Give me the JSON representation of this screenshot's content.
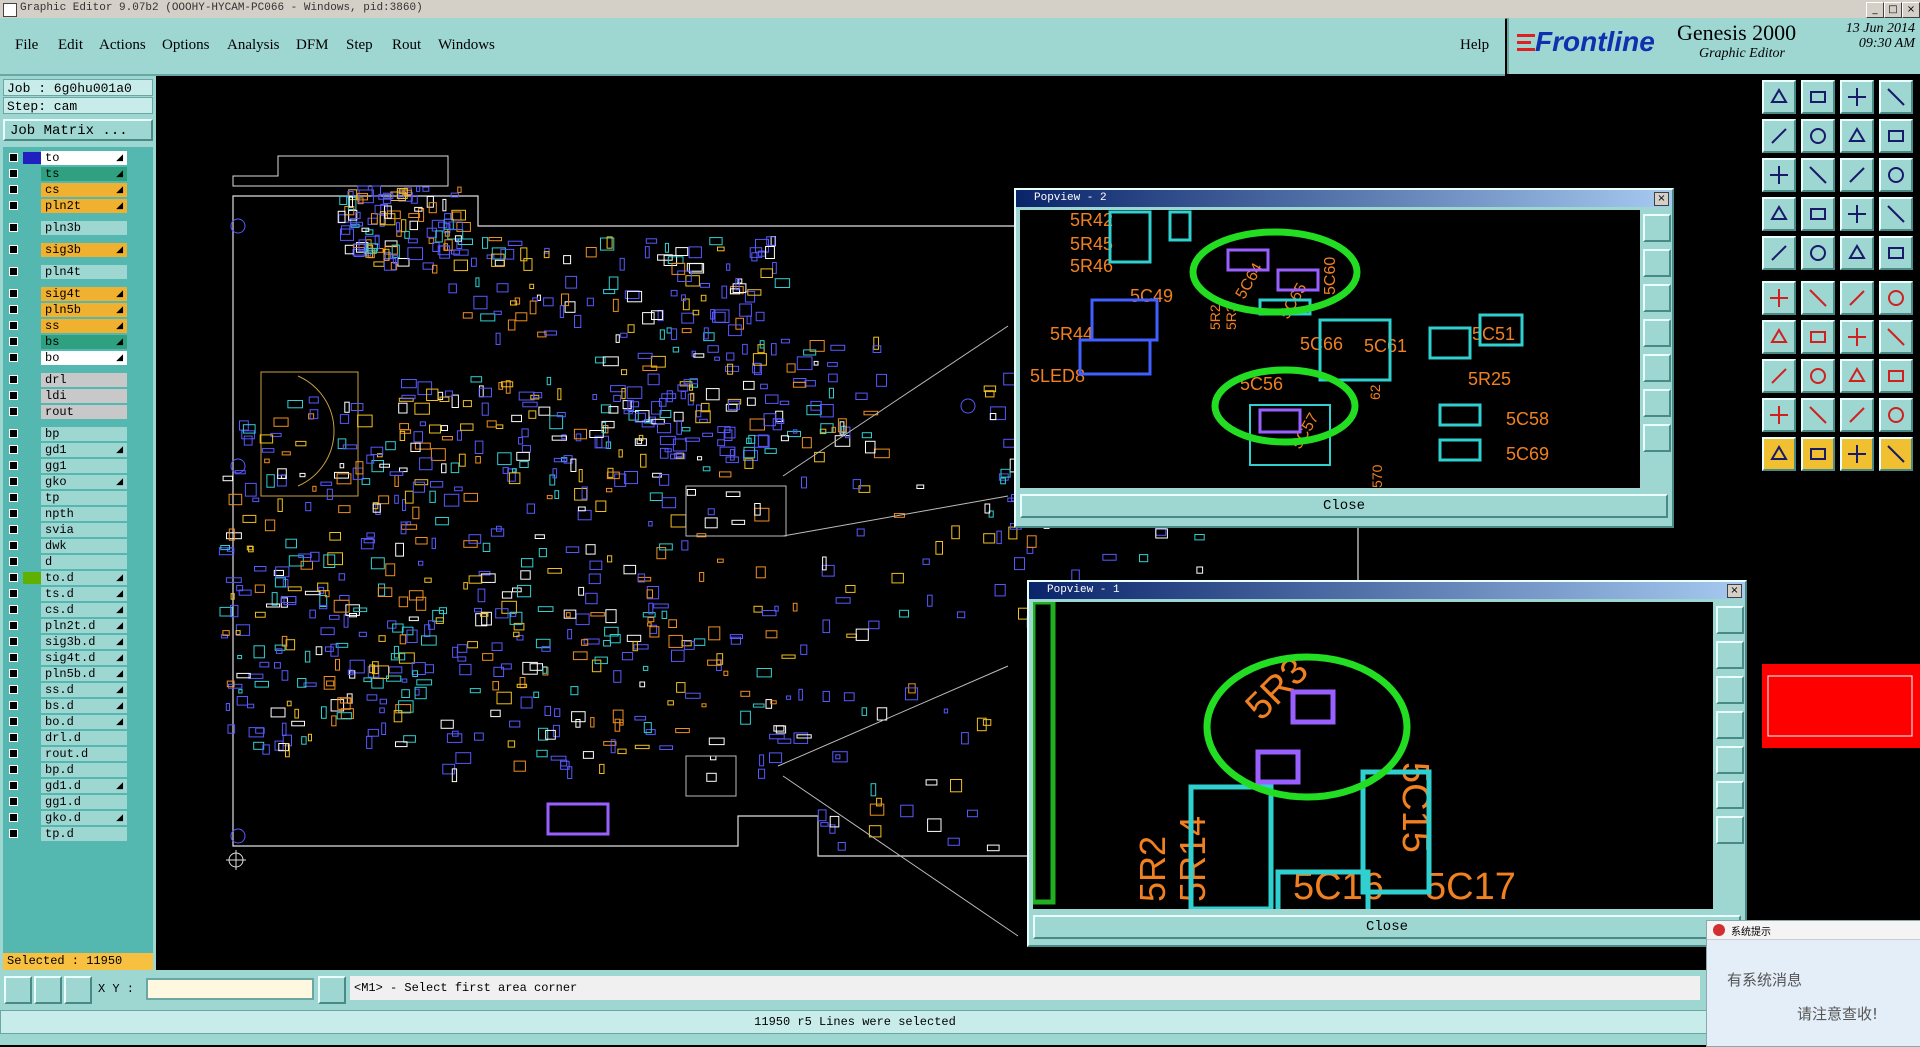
{
  "window": {
    "title": "Graphic Editor 9.07b2  (OOOHY-HYCAM-PC066 - Windows, pid:3860)"
  },
  "menu": {
    "items": [
      "File",
      "Edit",
      "Actions",
      "Options",
      "Analysis",
      "DFM",
      "Step",
      "Rout",
      "Windows"
    ],
    "help": "Help"
  },
  "brand": {
    "logo": "Frontline",
    "product": "Genesis 2000",
    "subtitle": "Graphic Editor",
    "date": "13 Jun 2014",
    "time": "09:30 AM"
  },
  "job": {
    "job_line": "Job : 6g0hu001a0",
    "step_line": "Step: cam",
    "matrix_button": "Job Matrix ..."
  },
  "layers": [
    {
      "name": "to",
      "color": "#ffffff",
      "arrow": true
    },
    {
      "name": "ts",
      "color": "#2fa080",
      "arrow": true
    },
    {
      "name": "cs",
      "color": "#f0b030",
      "arrow": true
    },
    {
      "name": "pln2t",
      "color": "#f0b030",
      "arrow": true
    },
    {
      "name": "pln3b",
      "color": "#9ed6d2",
      "arrow": false
    },
    {
      "name": "sig3b",
      "color": "#f0b030",
      "arrow": true
    },
    {
      "name": "pln4t",
      "color": "#9ed6d2",
      "arrow": false
    },
    {
      "name": "sig4t",
      "color": "#f0b030",
      "arrow": true
    },
    {
      "name": "pln5b",
      "color": "#f0b030",
      "arrow": true
    },
    {
      "name": "ss",
      "color": "#f0b030",
      "arrow": true
    },
    {
      "name": "bs",
      "color": "#2fa080",
      "arrow": true
    },
    {
      "name": "bo",
      "color": "#ffffff",
      "arrow": true
    },
    {
      "name": "drl",
      "color": "#c8c8c8",
      "arrow": false
    },
    {
      "name": "ldi",
      "color": "#c8c8c8",
      "arrow": false
    },
    {
      "name": "rout",
      "color": "#c8c8c8",
      "arrow": false
    },
    {
      "name": "bp",
      "color": "#9ed6d2",
      "arrow": false
    },
    {
      "name": "gd1",
      "color": "#9ed6d2",
      "arrow": true
    },
    {
      "name": "gg1",
      "color": "#9ed6d2",
      "arrow": false
    },
    {
      "name": "gko",
      "color": "#9ed6d2",
      "arrow": true
    },
    {
      "name": "tp",
      "color": "#9ed6d2",
      "arrow": false
    },
    {
      "name": "npth",
      "color": "#9ed6d2",
      "arrow": false
    },
    {
      "name": "svia",
      "color": "#9ed6d2",
      "arrow": false
    },
    {
      "name": "dwk",
      "color": "#9ed6d2",
      "arrow": false
    },
    {
      "name": "d",
      "color": "#9ed6d2",
      "arrow": false
    },
    {
      "name": "to.d",
      "color": "#9ed6d2",
      "arrow": true
    },
    {
      "name": "ts.d",
      "color": "#9ed6d2",
      "arrow": true
    },
    {
      "name": "cs.d",
      "color": "#9ed6d2",
      "arrow": true
    },
    {
      "name": "pln2t.d",
      "color": "#9ed6d2",
      "arrow": true
    },
    {
      "name": "sig3b.d",
      "color": "#9ed6d2",
      "arrow": true
    },
    {
      "name": "sig4t.d",
      "color": "#9ed6d2",
      "arrow": true
    },
    {
      "name": "pln5b.d",
      "color": "#9ed6d2",
      "arrow": true
    },
    {
      "name": "ss.d",
      "color": "#9ed6d2",
      "arrow": true
    },
    {
      "name": "bs.d",
      "color": "#9ed6d2",
      "arrow": true
    },
    {
      "name": "bo.d",
      "color": "#9ed6d2",
      "arrow": true
    },
    {
      "name": "drl.d",
      "color": "#9ed6d2",
      "arrow": false
    },
    {
      "name": "rout.d",
      "color": "#9ed6d2",
      "arrow": false
    },
    {
      "name": "bp.d",
      "color": "#9ed6d2",
      "arrow": false
    },
    {
      "name": "gd1.d",
      "color": "#9ed6d2",
      "arrow": true
    },
    {
      "name": "gg1.d",
      "color": "#9ed6d2",
      "arrow": false
    },
    {
      "name": "gko.d",
      "color": "#9ed6d2",
      "arrow": true
    },
    {
      "name": "tp.d",
      "color": "#9ed6d2",
      "arrow": false
    }
  ],
  "selected_text": "Selected : 11950",
  "popup2": {
    "title": "Popview - 2",
    "close": "Close",
    "labels": [
      "5R42",
      "5R45",
      "5R46",
      "5C49",
      "5R44",
      "5LED8",
      "5C64",
      "5C65",
      "5C60",
      "5C66",
      "5C61",
      "5C51",
      "5R25",
      "5C56",
      "5C57",
      "5C58",
      "5C69",
      "5R2",
      "5R3",
      "62",
      "570"
    ]
  },
  "popup1": {
    "title": "Popview - 1",
    "close": "Close",
    "labels": [
      "5R3",
      "5C15",
      "5R2",
      "5R14",
      "5C16",
      "5C17"
    ]
  },
  "bottom": {
    "xy_label": "X Y :",
    "prompt": "<M1> - Select first area corner",
    "status": "11950 r5 Lines were selected"
  },
  "notification": {
    "title": "系统提示",
    "line1": "有系统消息",
    "line2": "请注意查收!"
  },
  "colors": {
    "panel": "#9ed6d2",
    "highlight": "#22dd22",
    "pad": "#7060ff",
    "text_orange": "#f08020",
    "cyan": "#20e0e0"
  }
}
